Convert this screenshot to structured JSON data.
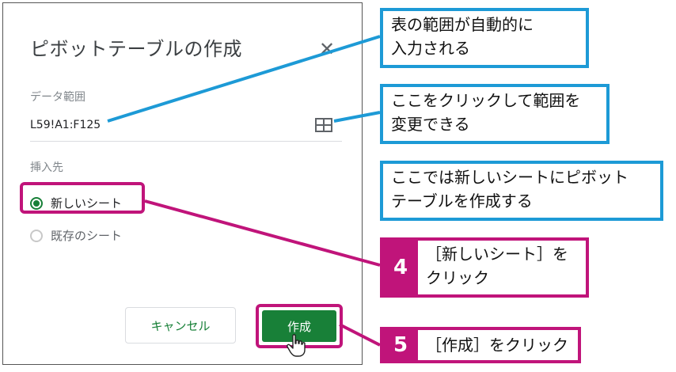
{
  "dialog": {
    "title": "ピボットテーブルの作成",
    "close_icon": "close-icon",
    "range_label": "データ範囲",
    "range_value": "L59!A1:F125",
    "grid_icon": "grid-select-icon",
    "insert_label": "挿入先",
    "options": [
      {
        "label": "新しいシート",
        "selected": true
      },
      {
        "label": "既存のシート",
        "selected": false
      }
    ],
    "cancel_label": "キャンセル",
    "create_label": "作成"
  },
  "callouts": {
    "auto_range": [
      "表の範囲が自動的に",
      "入力される"
    ],
    "change_range": [
      "ここをクリックして範囲を",
      "変更できる"
    ],
    "new_sheet_note": [
      "ここでは新しいシートにピボット",
      "テーブルを作成する"
    ]
  },
  "steps": [
    {
      "number": "4",
      "lines": [
        "［新しいシート］を",
        "クリック"
      ]
    },
    {
      "number": "5",
      "lines": [
        "［作成］をクリック"
      ]
    }
  ],
  "colors": {
    "accent_green": "#188038",
    "callout_blue": "#1d9ad6",
    "step_magenta": "#c0147a"
  }
}
